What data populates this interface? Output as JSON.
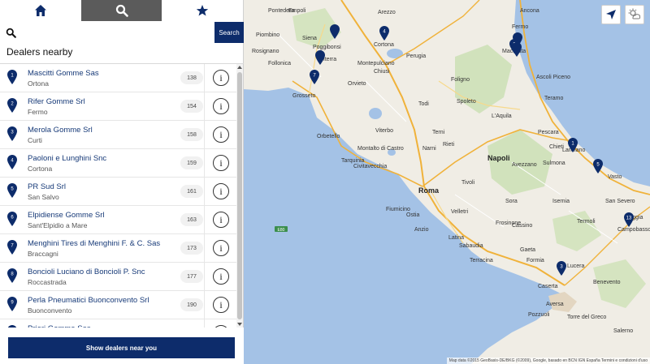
{
  "tabs": [
    {
      "icon": "home-icon"
    },
    {
      "icon": "search-icon",
      "active": true
    },
    {
      "icon": "star-icon"
    }
  ],
  "search": {
    "placeholder": "",
    "value": "",
    "button_label": "Search"
  },
  "section_title": "Dealers nearby",
  "dealers": [
    {
      "number": "1",
      "name": "Mascitti Gomme Sas",
      "city": "Ortona",
      "distance": "138"
    },
    {
      "number": "2",
      "name": "Rifer Gomme Srl",
      "city": "Fermo",
      "distance": "154"
    },
    {
      "number": "3",
      "name": "Merola Gomme Srl",
      "city": "Curti",
      "distance": "158"
    },
    {
      "number": "4",
      "name": "Paoloni e Lunghini Snc",
      "city": "Cortona",
      "distance": "159"
    },
    {
      "number": "5",
      "name": "PR Sud Srl",
      "city": "San Salvo",
      "distance": "161"
    },
    {
      "number": "6",
      "name": "Elpidiense Gomme Srl",
      "city": "Sant'Elpidio a Mare",
      "distance": "163"
    },
    {
      "number": "7",
      "name": "Menghini Tires di Menghini F. & C. Sas",
      "city": "Braccagni",
      "distance": "173"
    },
    {
      "number": "8",
      "name": "Boncioli Luciano di Boncioli P. Snc",
      "city": "Roccastrada",
      "distance": "177"
    },
    {
      "number": "9",
      "name": "Perla Pneumatici Buonconvento Srl",
      "city": "Buonconvento",
      "distance": "190"
    },
    {
      "number": "10",
      "name": "Priori Gomme Sas",
      "city": "",
      "distance": ""
    }
  ],
  "info_glyph": "i",
  "show_button_label": "Show dealers near you",
  "map": {
    "labels": [
      {
        "text": "Arezzo",
        "kind": "city"
      },
      {
        "text": "Siena",
        "kind": "city"
      },
      {
        "text": "Cortona",
        "kind": "city"
      },
      {
        "text": "Perugia",
        "kind": "city"
      },
      {
        "text": "Grosseto",
        "kind": "city"
      },
      {
        "text": "Orvieto",
        "kind": "city"
      },
      {
        "text": "Viterbo",
        "kind": "city"
      },
      {
        "text": "Terni",
        "kind": "city"
      },
      {
        "text": "Civitavecchia",
        "kind": "city"
      },
      {
        "text": "Roma",
        "kind": "big"
      },
      {
        "text": "Latina",
        "kind": "city"
      },
      {
        "text": "Frosinone",
        "kind": "city"
      },
      {
        "text": "L'Aquila",
        "kind": "city"
      },
      {
        "text": "Pescara",
        "kind": "city"
      },
      {
        "text": "Chieti",
        "kind": "city"
      },
      {
        "text": "Lanciano",
        "kind": "city"
      },
      {
        "text": "Vasto",
        "kind": "city"
      },
      {
        "text": "Termoli",
        "kind": "city"
      },
      {
        "text": "Campobasso",
        "kind": "city"
      },
      {
        "text": "Lucera",
        "kind": "city"
      },
      {
        "text": "Caserta",
        "kind": "city"
      },
      {
        "text": "Aversa",
        "kind": "city"
      },
      {
        "text": "Napoli",
        "kind": "big"
      },
      {
        "text": "Fermo",
        "kind": "city"
      },
      {
        "text": "Macerata",
        "kind": "city"
      },
      {
        "text": "Ascoli Piceno",
        "kind": "city"
      },
      {
        "text": "Teramo",
        "kind": "city"
      },
      {
        "text": "Ancona",
        "kind": "city"
      },
      {
        "text": "Foligno",
        "kind": "city"
      },
      {
        "text": "Spoleto",
        "kind": "city"
      },
      {
        "text": "Rieti",
        "kind": "city"
      },
      {
        "text": "Tivoli",
        "kind": "city"
      },
      {
        "text": "Anzio",
        "kind": "city"
      },
      {
        "text": "Gaeta",
        "kind": "city"
      },
      {
        "text": "Sora",
        "kind": "city"
      },
      {
        "text": "Isernia",
        "kind": "city"
      },
      {
        "text": "Benevento",
        "kind": "city"
      },
      {
        "text": "Piombino",
        "kind": "city"
      },
      {
        "text": "Follonica",
        "kind": "city"
      },
      {
        "text": "Orbetello",
        "kind": "city"
      },
      {
        "text": "Tarquinia",
        "kind": "city"
      },
      {
        "text": "Montalto di Castro",
        "kind": "city"
      },
      {
        "text": "Rosignano",
        "kind": "city"
      },
      {
        "text": "Pontedera",
        "kind": "city"
      },
      {
        "text": "Empoli",
        "kind": "city"
      },
      {
        "text": "Volterra",
        "kind": "city"
      },
      {
        "text": "Poggibonsi",
        "kind": "city"
      },
      {
        "text": "Montepulciano",
        "kind": "city"
      },
      {
        "text": "Chiusi",
        "kind": "city"
      },
      {
        "text": "Todi",
        "kind": "city"
      },
      {
        "text": "Narni",
        "kind": "city"
      },
      {
        "text": "Fiumicino",
        "kind": "city"
      },
      {
        "text": "Ostia",
        "kind": "city"
      },
      {
        "text": "Velletri",
        "kind": "city"
      },
      {
        "text": "Avezzano",
        "kind": "city"
      },
      {
        "text": "Sulmona",
        "kind": "city"
      },
      {
        "text": "Cassino",
        "kind": "city"
      },
      {
        "text": "Formia",
        "kind": "city"
      },
      {
        "text": "Terracina",
        "kind": "city"
      },
      {
        "text": "Sabaudia",
        "kind": "city"
      },
      {
        "text": "Pozzuoli",
        "kind": "city"
      },
      {
        "text": "Torre del Greco",
        "kind": "city"
      },
      {
        "text": "Salerno",
        "kind": "city"
      },
      {
        "text": "San Severo",
        "kind": "city"
      },
      {
        "text": "Foggia",
        "kind": "city"
      }
    ],
    "pins": [
      "4",
      "",
      "",
      "7",
      "",
      "2",
      "",
      "1",
      "5",
      "13",
      "3"
    ],
    "zoom_in_label": "+",
    "zoom_out_label": "−",
    "road_label": "E80",
    "attribution": "Map data ©2015 GeoBasis-DE/BKG (©2009), Google, basado en BCN IGN España   Termini e condizioni d'uso"
  },
  "colors": {
    "primary": "#0d2c6b",
    "active_tab": "#5b5b5b",
    "sea": "#a4c2e6",
    "land": "#f0ede5",
    "park": "#c9dfb1"
  }
}
